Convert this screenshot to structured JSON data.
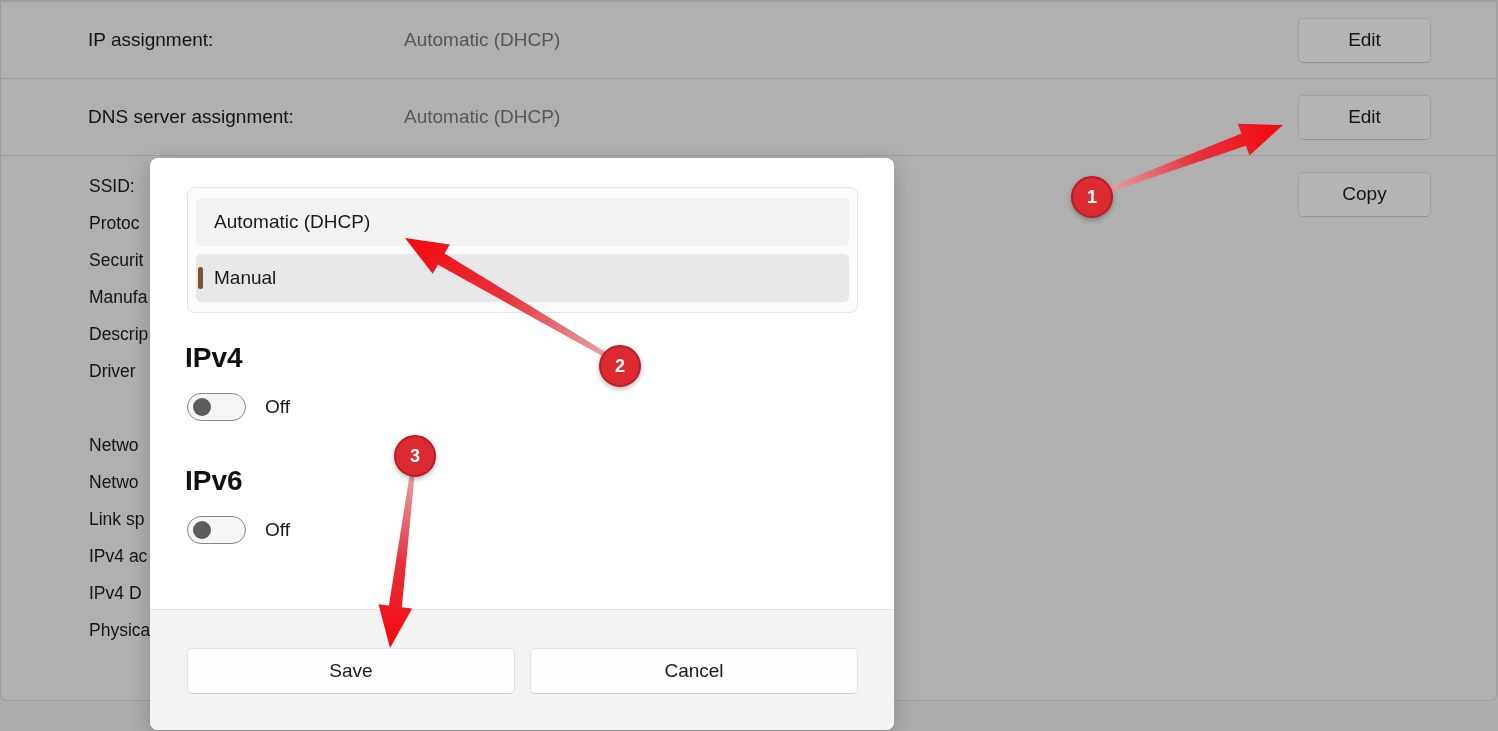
{
  "settings": {
    "rows": [
      {
        "label": "IP assignment:",
        "value": "Automatic (DHCP)",
        "button": "Edit"
      },
      {
        "label": "DNS server assignment:",
        "value": "Automatic (DHCP)",
        "button": "Edit"
      }
    ],
    "details": {
      "button": "Copy",
      "groups": [
        [
          "SSID:",
          "Protoc",
          "Securit",
          "Manufa",
          "Descrip",
          "Driver"
        ],
        [
          "Netwo",
          "Netwo",
          "Link sp",
          "IPv4 ac",
          "IPv4 D",
          "Physica"
        ]
      ]
    }
  },
  "dialog": {
    "options": [
      {
        "label": "Automatic (DHCP)",
        "selected": false
      },
      {
        "label": "Manual",
        "selected": true
      }
    ],
    "sections": [
      {
        "title": "IPv4",
        "toggle": {
          "on": false,
          "label": "Off"
        }
      },
      {
        "title": "IPv6",
        "toggle": {
          "on": false,
          "label": "Off"
        }
      }
    ],
    "buttons": [
      "Save",
      "Cancel"
    ]
  },
  "annotations": [
    {
      "label": "1"
    },
    {
      "label": "2"
    },
    {
      "label": "3"
    }
  ]
}
